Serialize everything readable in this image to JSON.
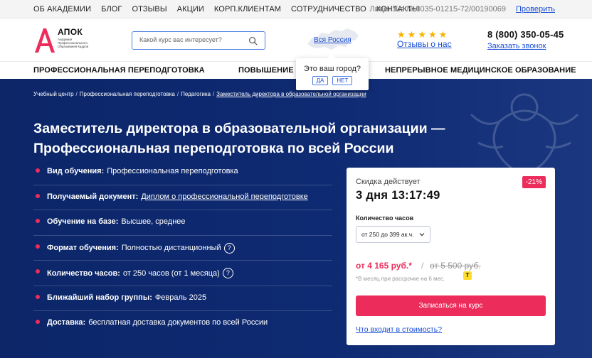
{
  "topbar": {
    "nav": [
      "ОБ АКАДЕМИИ",
      "БЛОГ",
      "ОТЗЫВЫ",
      "АКЦИИ",
      "КОРП.КЛИЕНТАМ",
      "СОТРУДНИЧЕСТВО",
      "КОНТАКТЫ"
    ],
    "license": "Лицензия №Л035-01215-72/00190069",
    "verify": "Проверить"
  },
  "header": {
    "logo_title": "АПОК",
    "logo_sub": "Академия Профессионального Образования Кадров",
    "search_placeholder": "Какой курс вас интересует?",
    "city_link": "Вся Россия",
    "reviews": "Отзывы о нас",
    "phone": "8 (800) 350-05-45",
    "callback": "Заказать звонок"
  },
  "city_popup": {
    "question": "Это ваш город?",
    "yes": "ДА",
    "no": "НЕТ"
  },
  "mainnav": [
    "ПРОФЕССИОНАЛЬНАЯ ПЕРЕПОДГОТОВКА",
    "ПОВЫШЕНИЕ К",
    "НЕПРЕРЫВНОЕ МЕДИЦИНСКОЕ ОБРАЗОВАНИЕ"
  ],
  "breadcrumb": [
    "Учебный центр",
    "Профессиональная переподготовка",
    "Педагогика",
    "Заместитель директора в образовательной организации"
  ],
  "title": "Заместитель директора в образовательной организации — Профессиональная переподготовка по всей России",
  "features": [
    {
      "label": "Вид обучения:",
      "value": "Профессиональная переподготовка"
    },
    {
      "label": "Получаемый документ:",
      "value": "Диплом о профессиональной переподготовке"
    },
    {
      "label": "Обучение на базе:",
      "value": "Высшее, среднее"
    },
    {
      "label": "Формат обучения:",
      "value": "Полностью дистанционный"
    },
    {
      "label": "Количество часов:",
      "value": "от 250 часов (от 1 месяца)"
    },
    {
      "label": "Ближайший набор группы:",
      "value": "Февраль 2025"
    },
    {
      "label": "Доставка:",
      "value": "бесплатная доставка документов по всей России"
    }
  ],
  "card": {
    "discount_label": "Скидка действует",
    "countdown": "3 дня 13:17:49",
    "badge": "-21%",
    "hours_label": "Количество часов",
    "hours_selected": "от 250 до 399 ак.ч.",
    "price": "от 4 165 руб.*",
    "price_sep": "/",
    "old_price": "от 5 500 руб.",
    "installment": "*В месяц при рассрочке на 6 мес.",
    "bank_logo_letter": "Т",
    "cta": "Записаться на курс",
    "whats_in": "Что входит в стоимость?"
  },
  "colors": {
    "accent": "#ec2d5c",
    "link": "#1a4fd6",
    "hero": "#0e2a72"
  }
}
